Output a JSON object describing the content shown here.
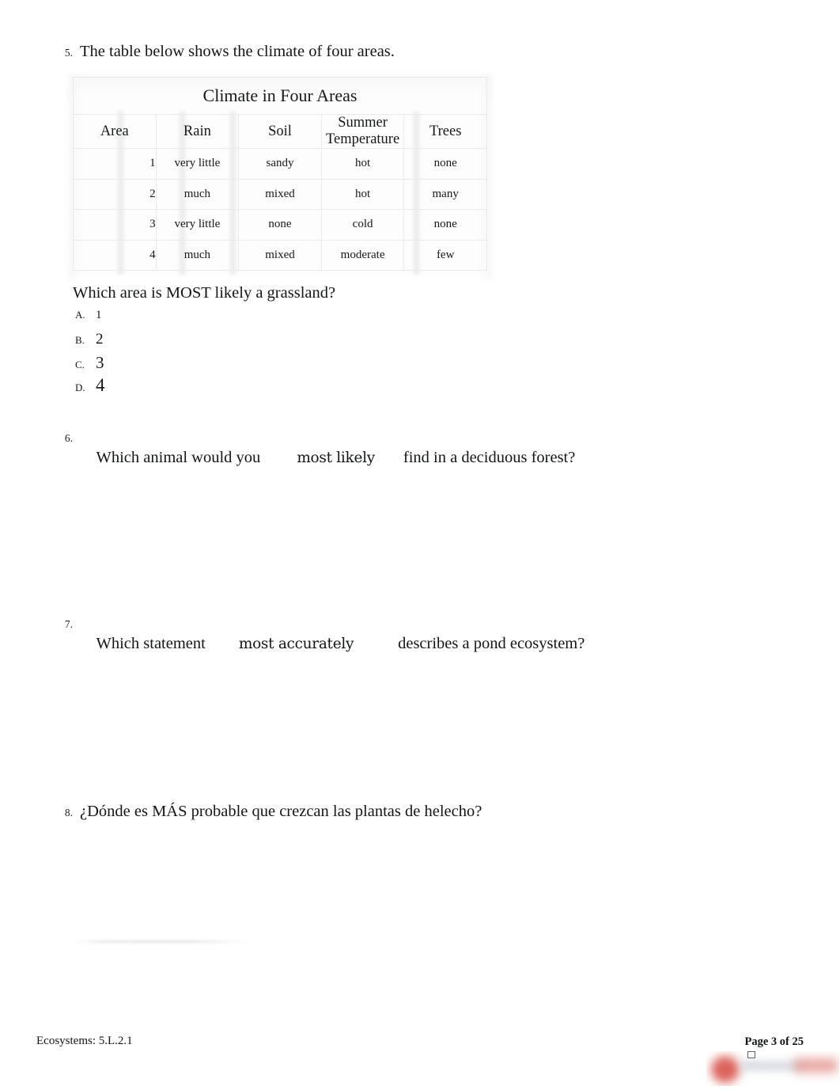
{
  "page": {
    "number_label": "Page 3 of 25",
    "footer_left": "Ecosystems: 5.L.2.1"
  },
  "questions": [
    {
      "number": "5.",
      "stem": "The table below shows the climate of four areas.",
      "sub_stem": "Which area is MOST likely a grassland?",
      "options": [
        {
          "letter": "A.",
          "value": "1"
        },
        {
          "letter": "B.",
          "value": "2"
        },
        {
          "letter": "C.",
          "value": "3"
        },
        {
          "letter": "D.",
          "value": "4"
        }
      ]
    },
    {
      "number": "6.",
      "segments": {
        "a": "Which animal would you",
        "b": "most likely",
        "c": "find in a deciduous forest?"
      }
    },
    {
      "number": "7.",
      "segments": {
        "a": "Which statement",
        "b": "most accurately",
        "c": "describes a pond ecosystem?"
      }
    },
    {
      "number": "8.",
      "stem": "¿Dónde es MÁS probable que crezcan las plantas de helecho?"
    }
  ],
  "table": {
    "title": "Climate in Four Areas",
    "headers": [
      "Area",
      "Rain",
      "Soil",
      "Summer Temperature",
      "Trees"
    ],
    "rows": [
      [
        "1",
        "very little",
        "sandy",
        "hot",
        "none"
      ],
      [
        "2",
        "much",
        "mixed",
        "hot",
        "many"
      ],
      [
        "3",
        "very little",
        "none",
        "cold",
        "none"
      ],
      [
        "4",
        "much",
        "mixed",
        "moderate",
        "few"
      ]
    ]
  }
}
